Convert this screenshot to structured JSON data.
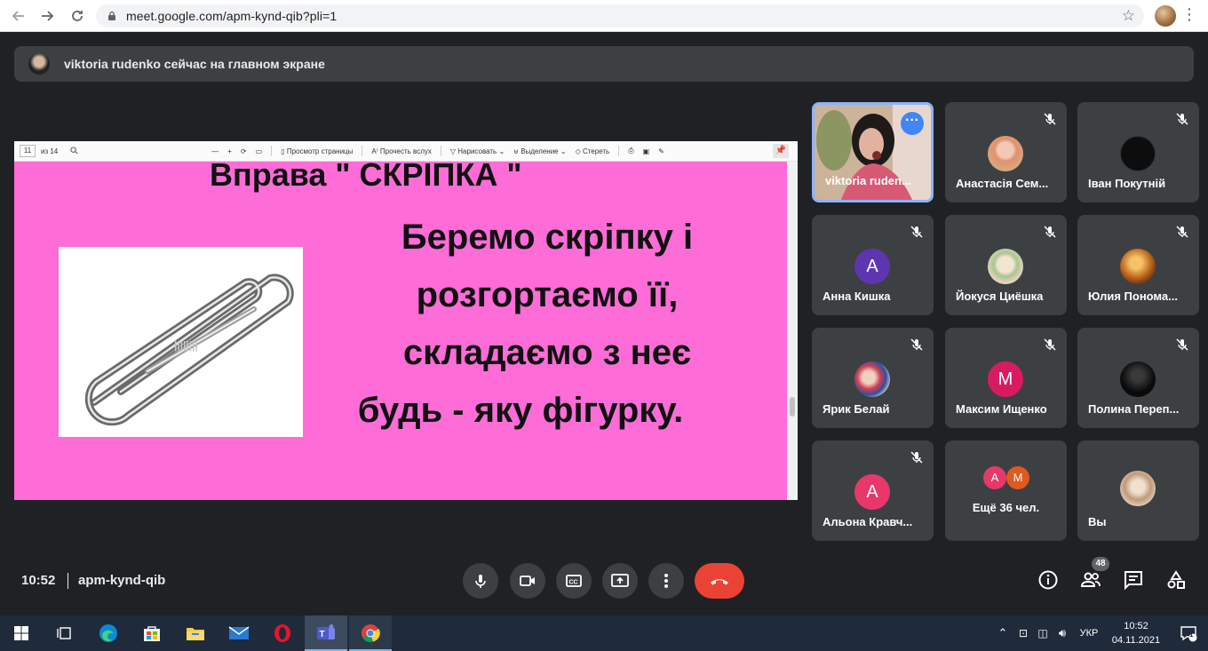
{
  "browser": {
    "url": "meet.google.com/apm-kynd-qib?pli=1",
    "icons": [
      "back-icon",
      "forward-icon",
      "reload-icon",
      "lock-icon",
      "star-icon"
    ]
  },
  "banner": {
    "text": "viktoria rudenko сейчас на главном экране"
  },
  "pdf_toolbar": {
    "page": "11",
    "of_pages": "из 14",
    "minus": "—",
    "plus": "+",
    "view": "Просмотр страницы",
    "read_aloud": "Прочесть вслух",
    "draw": "Нарисовать",
    "highlight": "Выделение",
    "erase": "Стереть"
  },
  "slide": {
    "title": "Вправа \" СКРІПКА \"",
    "line1": "Беремо скріпку і",
    "line2": "розгортаємо її,",
    "line3": "складаємо з неє",
    "line4": "будь - яку фігурку.",
    "image_label": "paperclip"
  },
  "participants": [
    {
      "name": "viktoria ruden...",
      "video": true
    },
    {
      "name": "Анастасія Сем..."
    },
    {
      "name": "Іван Покутній"
    },
    {
      "name": "Анна Кишка",
      "initial": "А",
      "color": "#5e35b1"
    },
    {
      "name": "Йокуся Циёшка"
    },
    {
      "name": "Юлия Понома..."
    },
    {
      "name": "Ярик Белай"
    },
    {
      "name": "Максим Ищенко",
      "initial": "М",
      "color": "#d81b60"
    },
    {
      "name": "Полина Переп..."
    },
    {
      "name": "Альона Кравч...",
      "initial": "А",
      "color": "#e8386b"
    },
    {
      "name": "Ещё 36 чел.",
      "chip1": "А",
      "chip2": "М"
    },
    {
      "name": "Вы"
    }
  ],
  "meeting": {
    "time": "10:52",
    "code": "apm-kynd-qib",
    "participants_count": "48"
  },
  "taskbar": {
    "lang": "УКР",
    "time": "10:52",
    "date": "04.11.2021",
    "notifications": "1"
  }
}
